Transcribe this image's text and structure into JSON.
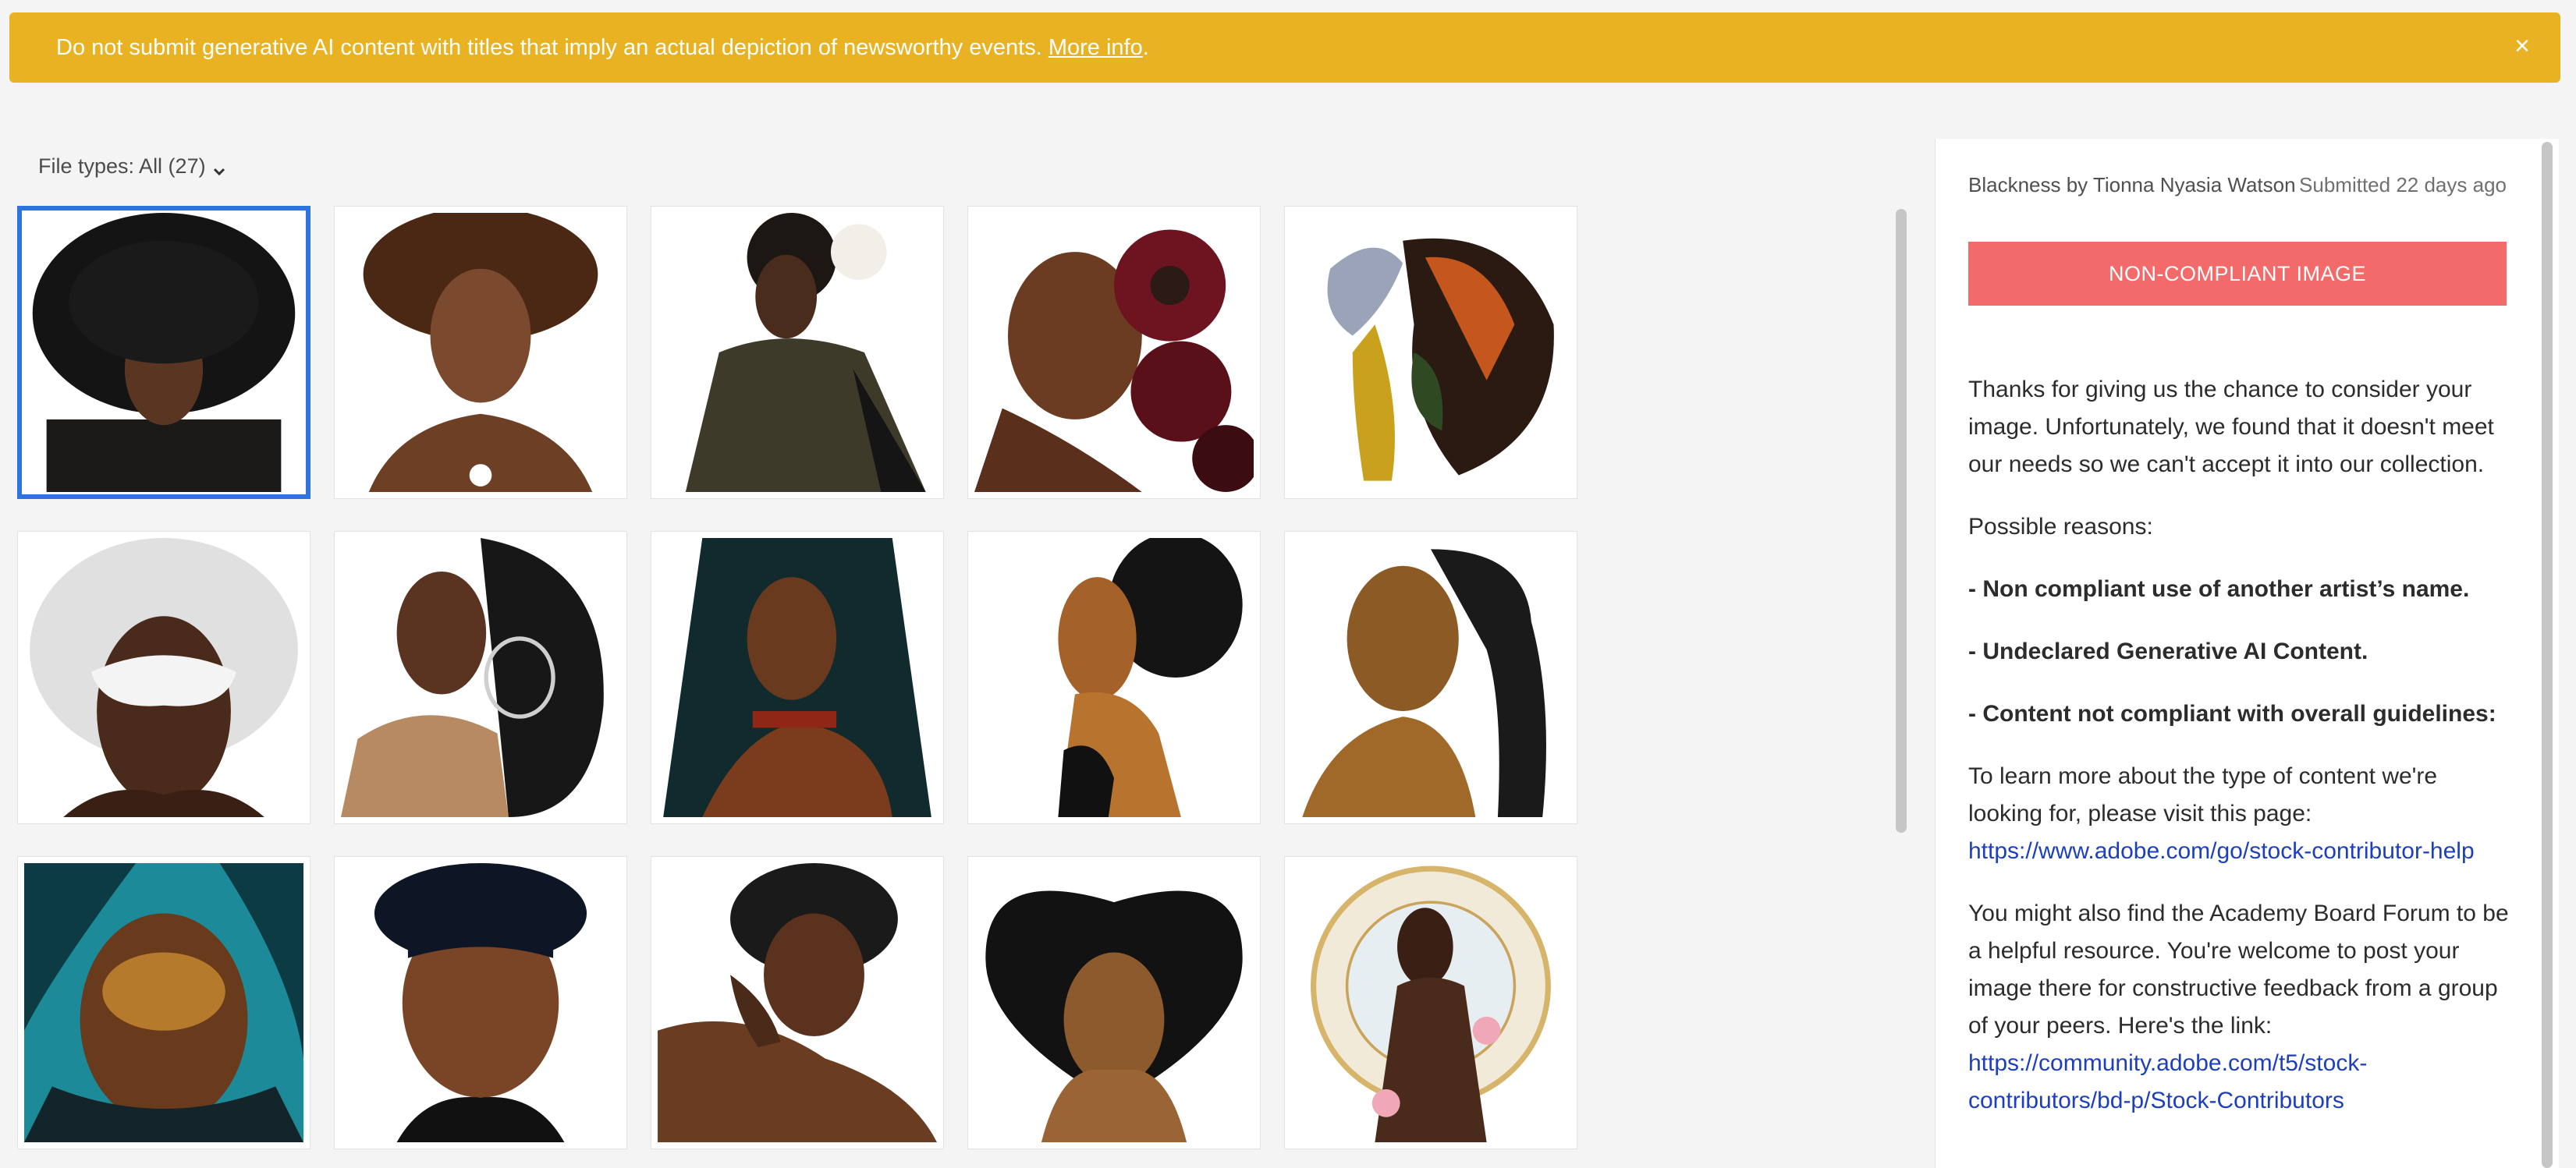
{
  "banner": {
    "text": "Do not submit generative AI content with titles that imply an actual depiction of newsworthy events.",
    "link": "More info",
    "after_link": ".",
    "close": "×"
  },
  "filter": {
    "label": "File types: All (27)"
  },
  "icons": {
    "close": "close-icon",
    "chevron": "chevron-down-icon"
  },
  "grid": {
    "selected_index": 0,
    "thumbnails": [
      "portrait-afro",
      "portrait-afro-heart",
      "portrait-white-flower",
      "portrait-red-flowers",
      "portrait-elephant-headwrap",
      "portrait-white-hair-mask",
      "portrait-braids-hoop",
      "portrait-long-braids",
      "portrait-profile-gold",
      "portrait-braided-ponytail",
      "portrait-teal-hair",
      "portrait-bangs",
      "portrait-hand-face",
      "portrait-afro-hands",
      "portrait-floral-halo"
    ]
  },
  "panel": {
    "title": "Blackness by Tionna Nyasia Watson",
    "submitted": "Submitted 22 days ago",
    "status": "NON-COMPLIANT IMAGE",
    "intro": "Thanks for giving us the chance to consider your image. Unfortunately, we found that it doesn't meet our needs so we can't accept it into our collection.",
    "reasons_heading": "Possible reasons:",
    "reason_1": "- Non compliant use of another artist’s name.",
    "reason_2": "- Undeclared Generative AI Content.",
    "reason_3": "- Content not compliant with overall guidelines:",
    "learn_more": "To learn more about the type of content we're looking for, please visit this page:",
    "help_link": "https://www.adobe.com/go/stock-contributor-help",
    "forum_text": "You might also find the Academy Board Forum to be a helpful resource. You're welcome to post your image there for constructive feedback from a group of your peers. Here's the link:",
    "forum_link": "https://community.adobe.com/t5/stock-contributors/bd-p/Stock-Contributors"
  },
  "colors": {
    "banner": "#e8b222",
    "selected_border": "#2d74e0",
    "badge": "#f26a6a",
    "link": "#1c3fbf"
  }
}
